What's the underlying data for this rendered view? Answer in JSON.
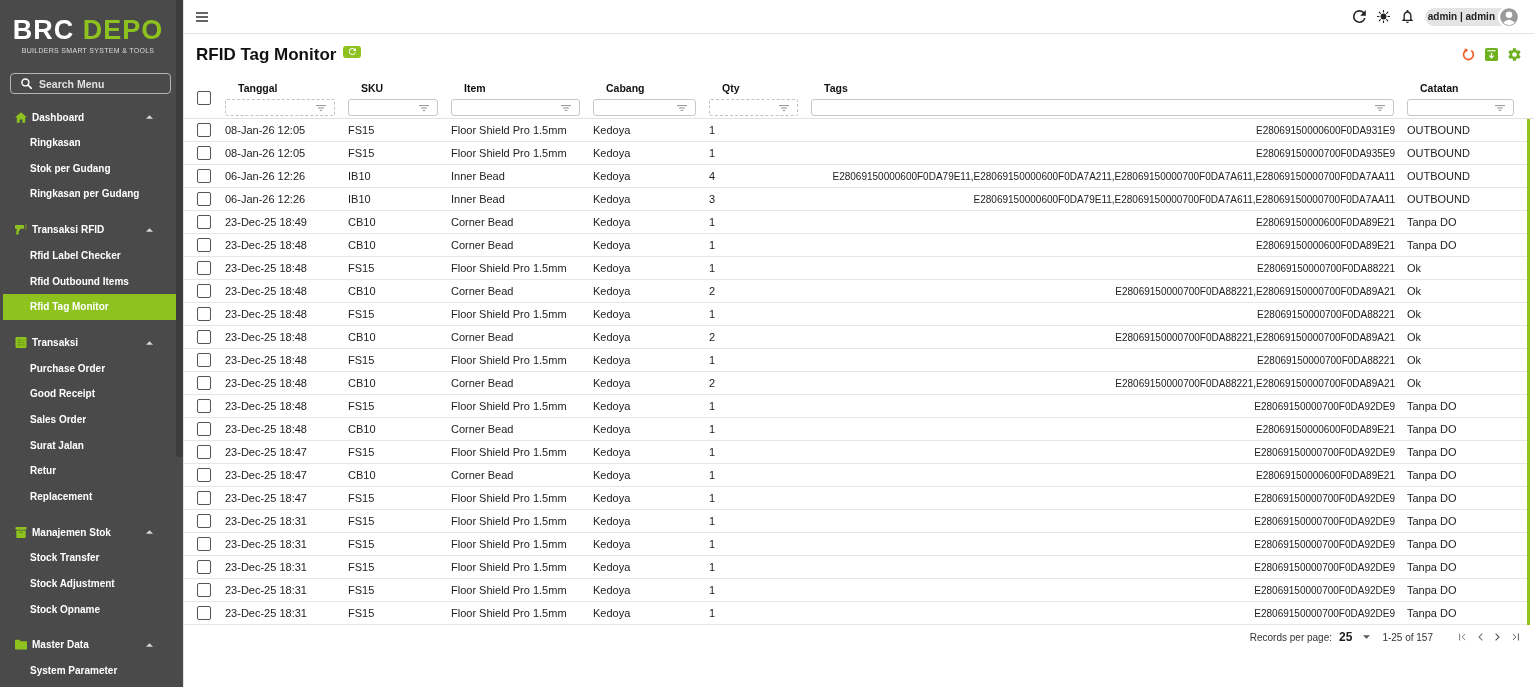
{
  "sidebar": {
    "logo": {
      "primary": "BRC",
      "accent": "DEPO",
      "tagline": "BUILDERS SMART SYSTEM & TOOLS"
    },
    "search": {
      "placeholder": "Search Menu"
    },
    "groups": [
      {
        "label": "Dashboard",
        "kind": "home",
        "expanded": true,
        "items": [
          {
            "label": "Ringkasan",
            "selected": false
          },
          {
            "label": "Stok per Gudang",
            "selected": false
          },
          {
            "label": "Ringkasan per Gudang",
            "selected": false
          }
        ]
      },
      {
        "label": "Transaksi RFID",
        "kind": "scanner",
        "expanded": true,
        "items": [
          {
            "label": "Rfid Label Checker",
            "selected": false
          },
          {
            "label": "Rfid Outbound Items",
            "selected": false
          },
          {
            "label": "Rfid Tag Monitor",
            "selected": true
          }
        ]
      },
      {
        "label": "Transaksi",
        "kind": "table",
        "expanded": true,
        "items": [
          {
            "label": "Purchase Order",
            "selected": false
          },
          {
            "label": "Good Receipt",
            "selected": false
          },
          {
            "label": "Sales Order",
            "selected": false
          },
          {
            "label": "Surat Jalan",
            "selected": false
          },
          {
            "label": "Retur",
            "selected": false
          },
          {
            "label": "Replacement",
            "selected": false
          }
        ]
      },
      {
        "label": "Manajemen Stok",
        "kind": "archive",
        "expanded": true,
        "items": [
          {
            "label": "Stock Transfer",
            "selected": false
          },
          {
            "label": "Stock Adjustment",
            "selected": false
          },
          {
            "label": "Stock Opname",
            "selected": false
          }
        ]
      },
      {
        "label": "Master Data",
        "kind": "folder",
        "expanded": true,
        "items": [
          {
            "label": "System Parameter",
            "selected": false
          }
        ]
      }
    ]
  },
  "topbar": {
    "user": "admin | admin"
  },
  "page": {
    "title": "RFID Tag Monitor"
  },
  "table": {
    "select_all_checked": false,
    "columns": [
      {
        "label": "Tanggal",
        "kind": "date"
      },
      {
        "label": "SKU",
        "kind": "text"
      },
      {
        "label": "Item",
        "kind": "text"
      },
      {
        "label": "Cabang",
        "kind": "text"
      },
      {
        "label": "Qty",
        "kind": "number"
      },
      {
        "label": "Tags",
        "kind": "list"
      },
      {
        "label": "Catatan",
        "kind": "text"
      }
    ],
    "rows": [
      {
        "selected": false,
        "cells": [
          "08-Jan-26 12:05",
          "FS15",
          "Floor Shield Pro 1.5mm",
          "Kedoya",
          "1",
          "E28069150000600F0DA931E9",
          "OUTBOUND"
        ]
      },
      {
        "selected": false,
        "cells": [
          "08-Jan-26 12:05",
          "FS15",
          "Floor Shield Pro 1.5mm",
          "Kedoya",
          "1",
          "E28069150000700F0DA935E9",
          "OUTBOUND"
        ]
      },
      {
        "selected": false,
        "cells": [
          "06-Jan-26 12:26",
          "IB10",
          "Inner Bead",
          "Kedoya",
          "4",
          "E28069150000600F0DA79E11,E28069150000600F0DA7A211,E28069150000700F0DA7A611,E28069150000700F0DA7AA11",
          "OUTBOUND"
        ]
      },
      {
        "selected": false,
        "cells": [
          "06-Jan-26 12:26",
          "IB10",
          "Inner Bead",
          "Kedoya",
          "3",
          "E28069150000600F0DA79E11,E28069150000700F0DA7A611,E28069150000700F0DA7AA11",
          "OUTBOUND"
        ]
      },
      {
        "selected": false,
        "cells": [
          "23-Dec-25 18:49",
          "CB10",
          "Corner Bead",
          "Kedoya",
          "1",
          "E28069150000600F0DA89E21",
          "Tanpa DO"
        ]
      },
      {
        "selected": false,
        "cells": [
          "23-Dec-25 18:48",
          "CB10",
          "Corner Bead",
          "Kedoya",
          "1",
          "E28069150000600F0DA89E21",
          "Tanpa DO"
        ]
      },
      {
        "selected": false,
        "cells": [
          "23-Dec-25 18:48",
          "FS15",
          "Floor Shield Pro 1.5mm",
          "Kedoya",
          "1",
          "E28069150000700F0DA88221",
          "Ok"
        ]
      },
      {
        "selected": false,
        "cells": [
          "23-Dec-25 18:48",
          "CB10",
          "Corner Bead",
          "Kedoya",
          "2",
          "E28069150000700F0DA88221,E28069150000700F0DA89A21",
          "Ok"
        ]
      },
      {
        "selected": false,
        "cells": [
          "23-Dec-25 18:48",
          "FS15",
          "Floor Shield Pro 1.5mm",
          "Kedoya",
          "1",
          "E28069150000700F0DA88221",
          "Ok"
        ]
      },
      {
        "selected": false,
        "cells": [
          "23-Dec-25 18:48",
          "CB10",
          "Corner Bead",
          "Kedoya",
          "2",
          "E28069150000700F0DA88221,E28069150000700F0DA89A21",
          "Ok"
        ]
      },
      {
        "selected": false,
        "cells": [
          "23-Dec-25 18:48",
          "FS15",
          "Floor Shield Pro 1.5mm",
          "Kedoya",
          "1",
          "E28069150000700F0DA88221",
          "Ok"
        ]
      },
      {
        "selected": false,
        "cells": [
          "23-Dec-25 18:48",
          "CB10",
          "Corner Bead",
          "Kedoya",
          "2",
          "E28069150000700F0DA88221,E28069150000700F0DA89A21",
          "Ok"
        ]
      },
      {
        "selected": false,
        "cells": [
          "23-Dec-25 18:48",
          "FS15",
          "Floor Shield Pro 1.5mm",
          "Kedoya",
          "1",
          "E28069150000700F0DA92DE9",
          "Tanpa DO"
        ]
      },
      {
        "selected": false,
        "cells": [
          "23-Dec-25 18:48",
          "CB10",
          "Corner Bead",
          "Kedoya",
          "1",
          "E28069150000600F0DA89E21",
          "Tanpa DO"
        ]
      },
      {
        "selected": false,
        "cells": [
          "23-Dec-25 18:47",
          "FS15",
          "Floor Shield Pro 1.5mm",
          "Kedoya",
          "1",
          "E28069150000700F0DA92DE9",
          "Tanpa DO"
        ]
      },
      {
        "selected": false,
        "cells": [
          "23-Dec-25 18:47",
          "CB10",
          "Corner Bead",
          "Kedoya",
          "1",
          "E28069150000600F0DA89E21",
          "Tanpa DO"
        ]
      },
      {
        "selected": false,
        "cells": [
          "23-Dec-25 18:47",
          "FS15",
          "Floor Shield Pro 1.5mm",
          "Kedoya",
          "1",
          "E28069150000700F0DA92DE9",
          "Tanpa DO"
        ]
      },
      {
        "selected": false,
        "cells": [
          "23-Dec-25 18:31",
          "FS15",
          "Floor Shield Pro 1.5mm",
          "Kedoya",
          "1",
          "E28069150000700F0DA92DE9",
          "Tanpa DO"
        ]
      },
      {
        "selected": false,
        "cells": [
          "23-Dec-25 18:31",
          "FS15",
          "Floor Shield Pro 1.5mm",
          "Kedoya",
          "1",
          "E28069150000700F0DA92DE9",
          "Tanpa DO"
        ]
      },
      {
        "selected": false,
        "cells": [
          "23-Dec-25 18:31",
          "FS15",
          "Floor Shield Pro 1.5mm",
          "Kedoya",
          "1",
          "E28069150000700F0DA92DE9",
          "Tanpa DO"
        ]
      },
      {
        "selected": false,
        "cells": [
          "23-Dec-25 18:31",
          "FS15",
          "Floor Shield Pro 1.5mm",
          "Kedoya",
          "1",
          "E28069150000700F0DA92DE9",
          "Tanpa DO"
        ]
      },
      {
        "selected": false,
        "cells": [
          "23-Dec-25 18:31",
          "FS15",
          "Floor Shield Pro 1.5mm",
          "Kedoya",
          "1",
          "E28069150000700F0DA92DE9",
          "Tanpa DO"
        ]
      }
    ]
  },
  "pagination": {
    "label": "Records per page:",
    "per_page": "25",
    "range": "1-25 of 157"
  }
}
